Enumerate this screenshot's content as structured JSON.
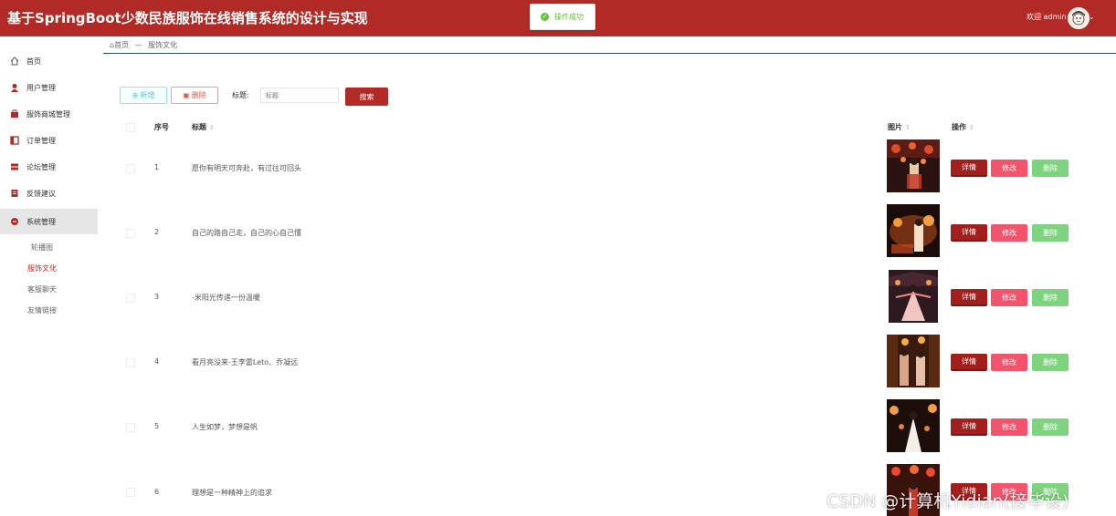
{
  "app": {
    "title": "基于SpringBoot少数民族服饰在线销售系统的设计与实现"
  },
  "header": {
    "welcome": "欢迎 admin",
    "caret": "⌄"
  },
  "toast": {
    "message": "操作成功"
  },
  "sidebar": {
    "items": [
      {
        "label": "首页",
        "icon": "home-icon"
      },
      {
        "label": "用户管理",
        "icon": "user-icon"
      },
      {
        "label": "服饰商城管理",
        "icon": "shop-icon"
      },
      {
        "label": "订单管理",
        "icon": "order-icon"
      },
      {
        "label": "论坛管理",
        "icon": "forum-icon"
      },
      {
        "label": "反馈建议",
        "icon": "feedback-icon"
      },
      {
        "label": "系统管理",
        "icon": "system-icon"
      }
    ],
    "subitems": [
      {
        "label": "轮播图"
      },
      {
        "label": "服饰文化"
      },
      {
        "label": "客服聊天"
      },
      {
        "label": "友情链接"
      }
    ]
  },
  "breadcrumb": {
    "home": "首页",
    "separator": "—",
    "current": "服饰文化"
  },
  "toolbar": {
    "add_label": "新增",
    "delete_label": "删除",
    "search_label": "标题:",
    "search_placeholder": "标题",
    "search_button": "搜索"
  },
  "table": {
    "headers": {
      "index": "序号",
      "title": "标题",
      "image": "图片",
      "actions": "操作"
    },
    "action_labels": {
      "detail": "详情",
      "edit": "修改",
      "remove": "删除"
    },
    "rows": [
      {
        "index": "1",
        "title": "愿你有明天可奔赴，有过往可回头"
      },
      {
        "index": "2",
        "title": "自己的路自己走，自己的心自己懂"
      },
      {
        "index": "3",
        "title": "-米阳光传递一份温暖"
      },
      {
        "index": "4",
        "title": "看月亮没来-王李雷Leto、乔凝远"
      },
      {
        "index": "5",
        "title": "人生如梦，梦想是帆"
      },
      {
        "index": "6",
        "title": "理想是一种精神上的追求"
      }
    ]
  },
  "watermark": "CSDN @计算机Yidian(接毕设)",
  "colors": {
    "brand": "#b22a25",
    "edit": "#f2546b",
    "remove": "#7ed37e",
    "success": "#67c23a"
  }
}
